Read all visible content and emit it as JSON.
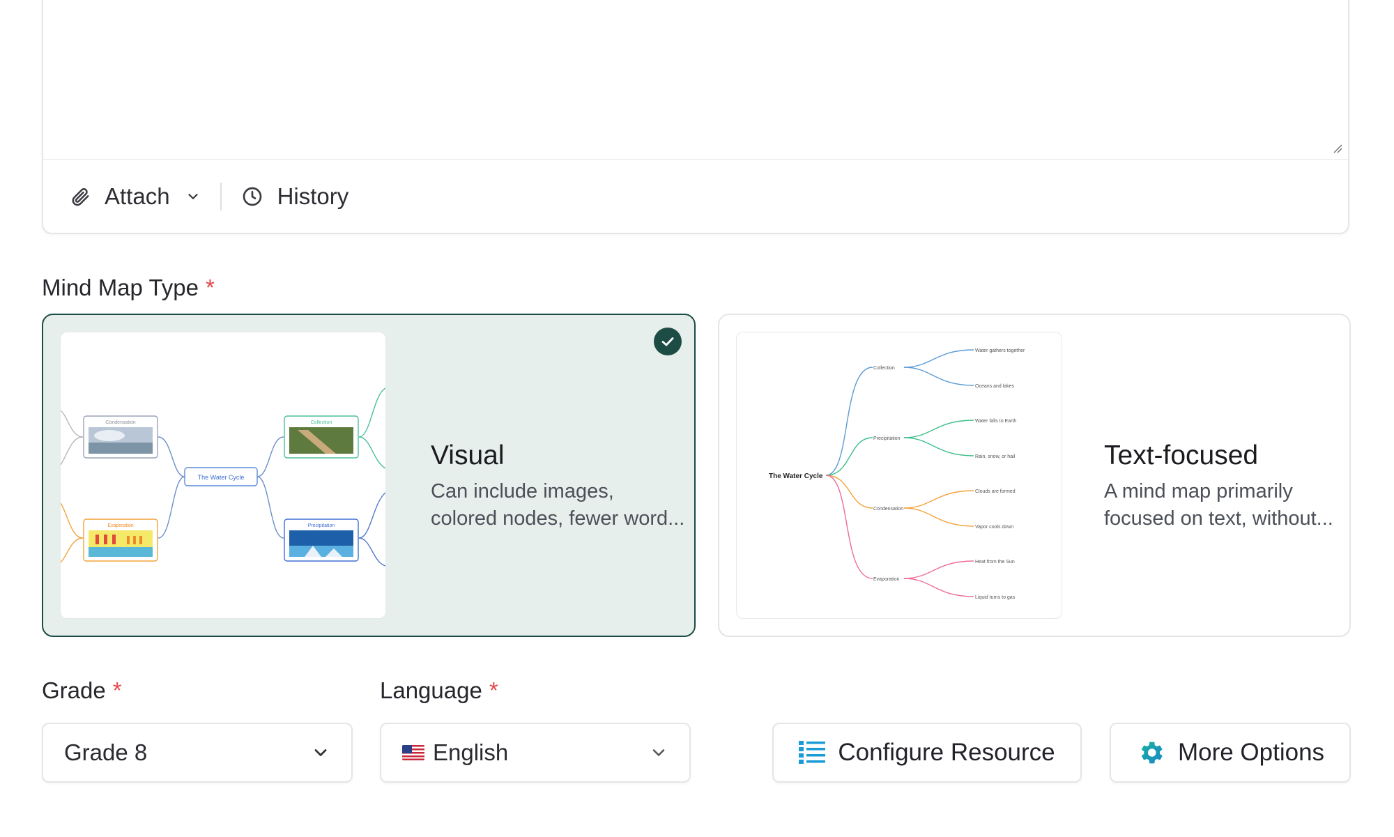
{
  "prompt": {
    "attach_label": "Attach",
    "history_label": "History"
  },
  "mind_map_type": {
    "label": "Mind Map Type",
    "required_mark": "*",
    "options": [
      {
        "title": "Visual",
        "description_line1": "Can include images,",
        "description_line2": "colored nodes, fewer word...",
        "selected": true,
        "preview": {
          "center": "The Water Cycle",
          "nodes": [
            "Condensation",
            "Collection",
            "Evaporation",
            "Precipitation"
          ]
        }
      },
      {
        "title": "Text-focused",
        "description_line1": "A mind map primarily",
        "description_line2": "focused on text, without...",
        "selected": false,
        "preview": {
          "center": "The Water Cycle",
          "branches": [
            {
              "name": "Collection",
              "color": "#5b9bd5",
              "leaves": [
                "Water gathers together",
                "Oceans and lakes"
              ]
            },
            {
              "name": "Precipitation",
              "color": "#3cbf8a",
              "leaves": [
                "Water falls to Earth",
                "Rain, snow, or hail"
              ]
            },
            {
              "name": "Condensation",
              "color": "#f3a23a",
              "leaves": [
                "Clouds are formed",
                "Vapor cools down"
              ]
            },
            {
              "name": "Evaporation",
              "color": "#ec6d97",
              "leaves": [
                "Heat from the Sun",
                "Liquid turns to gas"
              ]
            }
          ]
        }
      }
    ]
  },
  "grade": {
    "label": "Grade",
    "required_mark": "*",
    "value": "Grade 8"
  },
  "language": {
    "label": "Language",
    "required_mark": "*",
    "value": "English",
    "flag": "us-flag-icon"
  },
  "actions": {
    "configure_label": "Configure Resource",
    "more_label": "More Options"
  },
  "colors": {
    "accent": "#1d4c44",
    "selected_bg": "#e7efed",
    "required": "#e5484d",
    "configure_icon": "#1a9bd7",
    "more_icon": "#17a589"
  }
}
